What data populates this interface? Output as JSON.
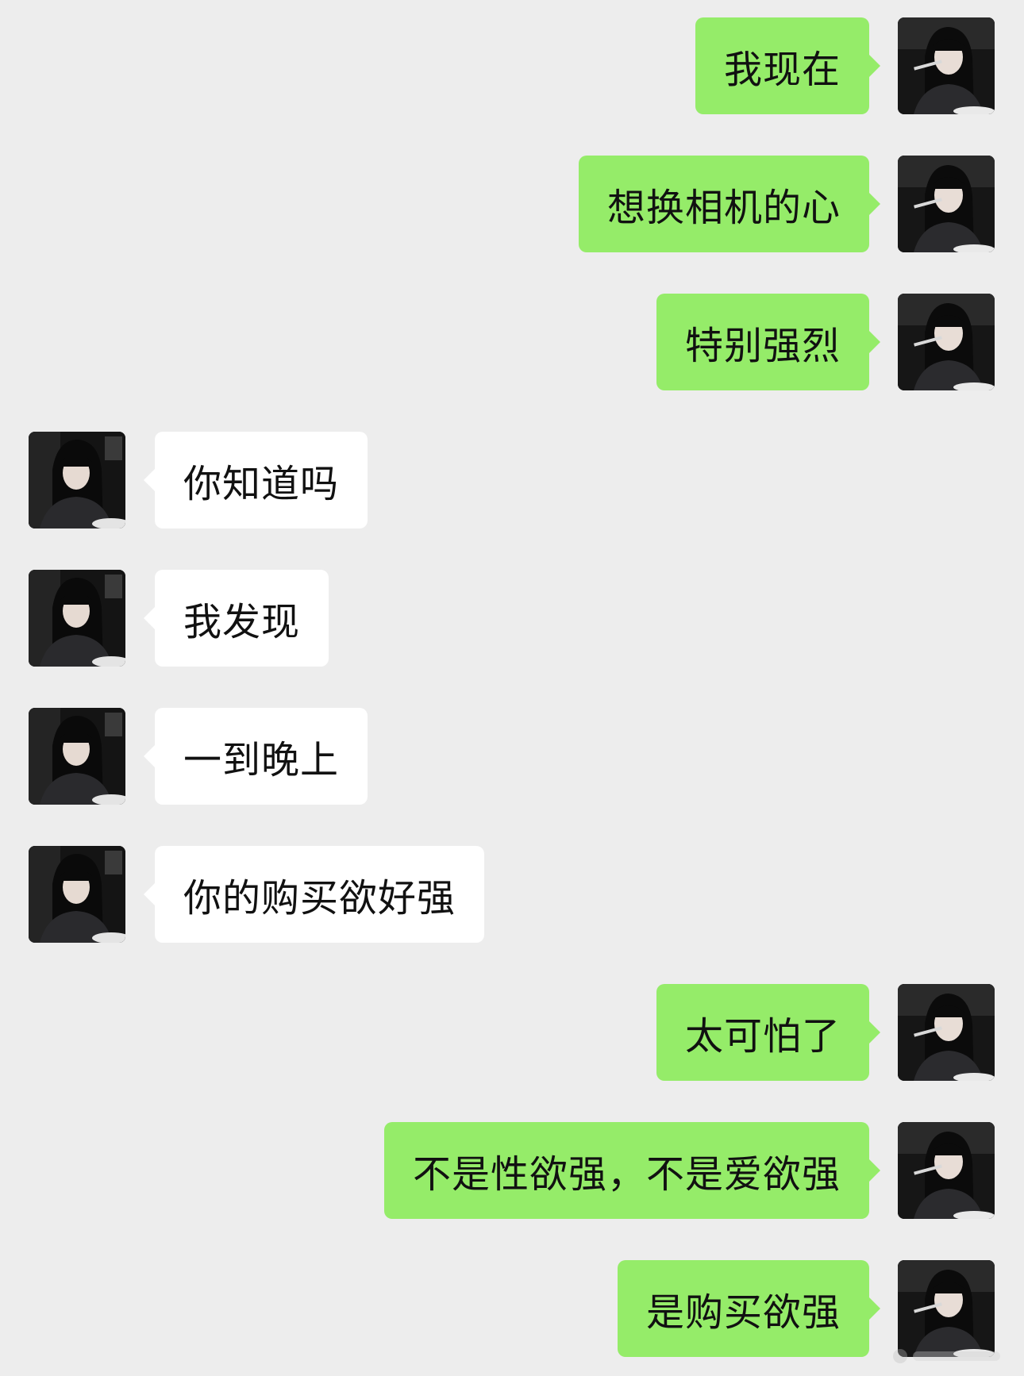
{
  "chat": {
    "messages": [
      {
        "side": "sent",
        "text": "我现在"
      },
      {
        "side": "sent",
        "text": "想换相机的心"
      },
      {
        "side": "sent",
        "text": "特别强烈"
      },
      {
        "side": "received",
        "text": "你知道吗"
      },
      {
        "side": "received",
        "text": "我发现"
      },
      {
        "side": "received",
        "text": "一到晚上"
      },
      {
        "side": "received",
        "text": "你的购买欲好强"
      },
      {
        "side": "sent",
        "text": "太可怕了"
      },
      {
        "side": "sent",
        "text": "不是性欲强，不是爱欲强"
      },
      {
        "side": "sent",
        "text": "是购买欲强"
      }
    ]
  },
  "colors": {
    "background": "#ededed",
    "sent_bubble": "#95ec69",
    "received_bubble": "#ffffff",
    "text": "#111111"
  },
  "icons": {
    "avatar": "avatar-photo-icon",
    "watermark": "watermark-icon"
  }
}
